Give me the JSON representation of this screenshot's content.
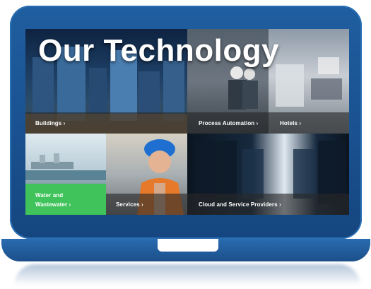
{
  "hero": {
    "title": "Our Technology"
  },
  "tiles": [
    {
      "label": "Buildings ›"
    },
    {
      "label": "Process Automation ›"
    },
    {
      "label": "Hotels ›"
    },
    {
      "label_line1": "Water and",
      "label_line2": "Wastewater ›"
    },
    {
      "label": "Services ›"
    },
    {
      "label": "Cloud and Service Providers ›"
    }
  ],
  "colors": {
    "laptop_blue": "#1a5190",
    "water_tile_green": "#3fc35a",
    "label_bar": "#333333"
  }
}
